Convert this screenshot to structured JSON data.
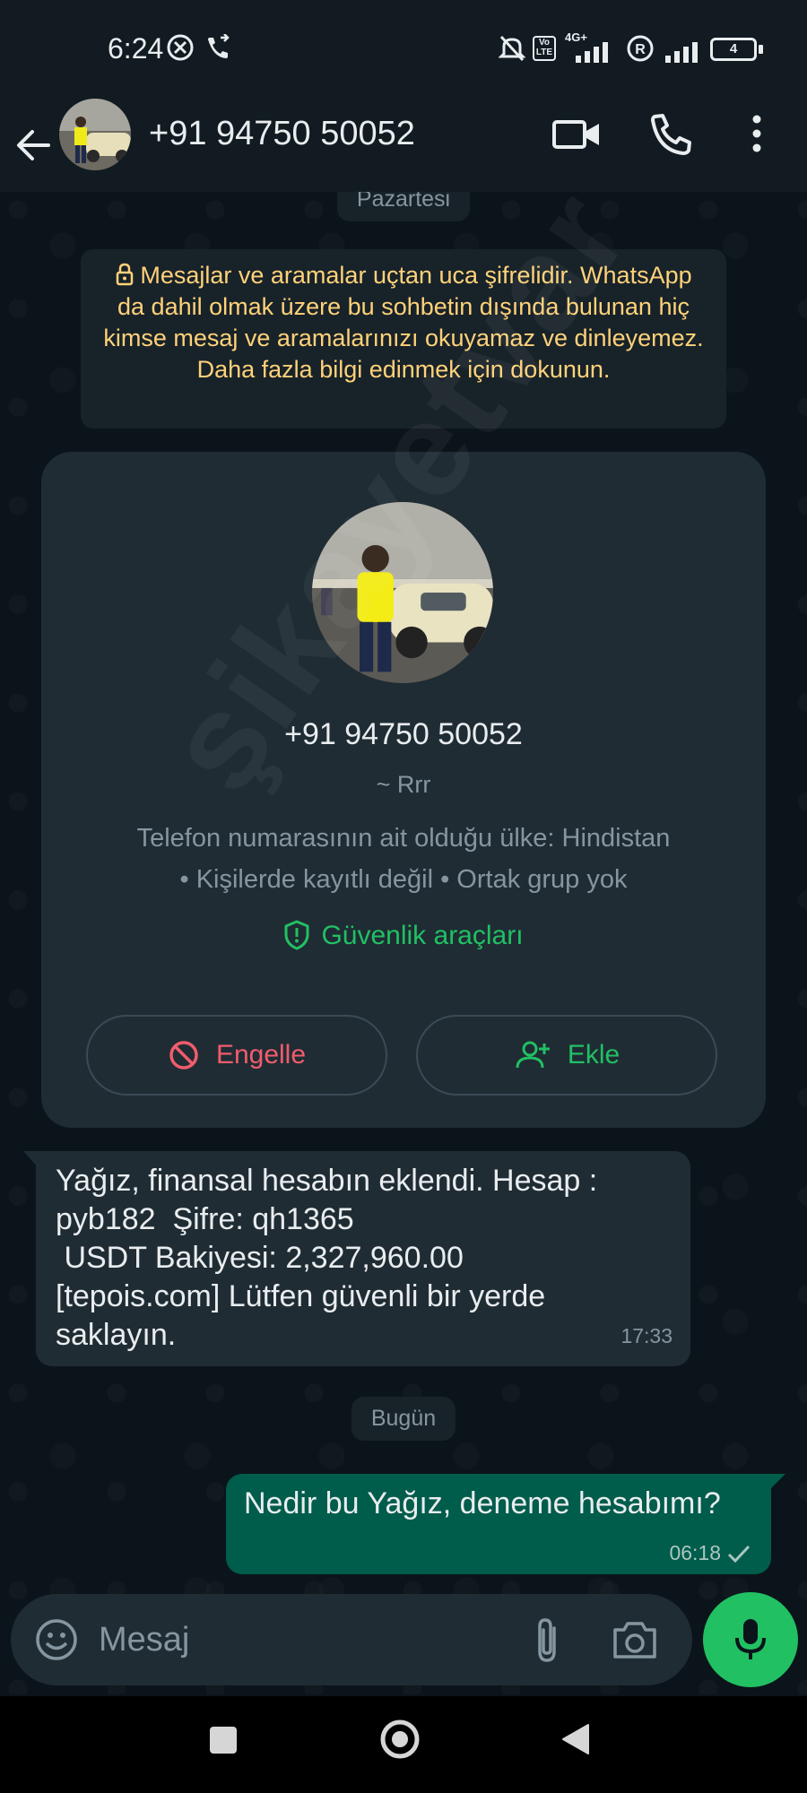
{
  "status_bar": {
    "time": "6:24",
    "volte_label": "Vo LTE",
    "net_label": "4G+",
    "battery": "4"
  },
  "header": {
    "title": "+91 94750 50052"
  },
  "chat": {
    "date_top": "Pazartesi",
    "encryption_notice": "Mesajlar ve aramalar uçtan uca şifrelidir. WhatsApp da dahil olmak üzere bu sohbetin dışında bulunan hiç kimse mesaj ve aramalarınızı okuyamaz ve dinleyemez. Daha fazla bilgi edinmek için dokunun.",
    "contact_card": {
      "phone": "+91 94750 50052",
      "name": "~ Rrr",
      "info_line1": "Telefon numarasının ait olduğu ülke: Hindistan",
      "info_line2": "• Kişilerde kayıtlı değil • Ortak grup yok",
      "security_label": "Güvenlik araçları",
      "block_label": "Engelle",
      "add_label": "Ekle"
    },
    "incoming_message": {
      "lines": [
        "Yağız, finansal hesabın eklendi. Hesap :",
        "pyb182  Şifre: qh1365",
        " USDT Bakiyesi: 2,327,960.00",
        "[tepois.com] Lütfen güvenli bir yerde",
        "saklayın."
      ],
      "time": "17:33"
    },
    "date_today": "Bugün",
    "outgoing_message": {
      "text": "Nedir bu Yağız, deneme hesabımı?",
      "time": "06:18"
    },
    "watermark": "şikayetvar"
  },
  "input": {
    "placeholder": "Mesaj"
  },
  "colors": {
    "accent_green": "#21c063",
    "danger_red": "#f15c6d",
    "notice_yellow": "#ffd279",
    "outgoing_bubble": "#005c4b"
  }
}
